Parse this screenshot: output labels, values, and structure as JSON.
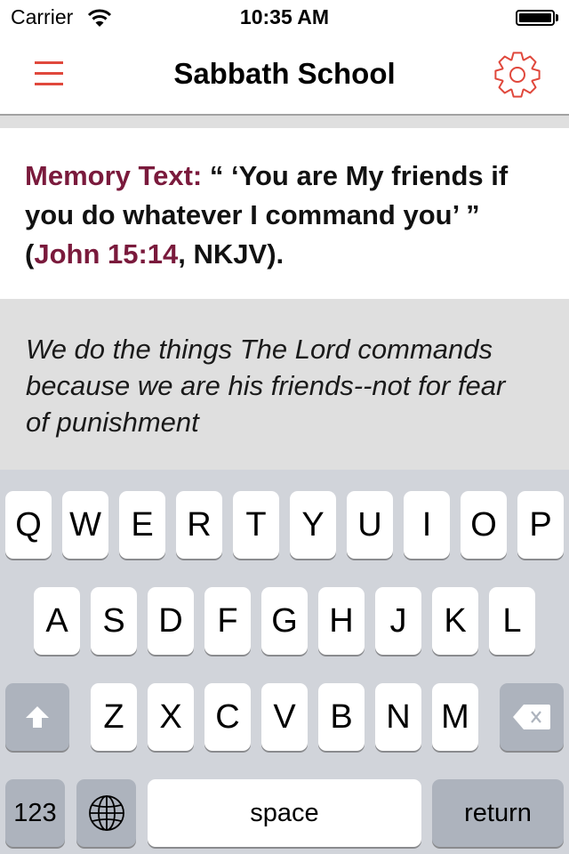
{
  "status_bar": {
    "carrier": "Carrier",
    "time": "10:35 AM",
    "wifi_icon": "wifi-icon",
    "battery_icon": "battery-full-icon"
  },
  "nav_bar": {
    "title": "Sabbath School",
    "menu_icon": "hamburger-menu-icon",
    "settings_icon": "gear-icon",
    "accent_color": "#e0483c"
  },
  "memory": {
    "label": "Memory Text:",
    "quote_part1": " “ ‘You are My friends if you do whatever I command you’ ” (",
    "reference": "John 15:14",
    "quote_part2": ", NKJV).",
    "accent_color": "#7a1a3c"
  },
  "note": {
    "text": "We do the things The Lord commands because we are his friends--not for fear of punishment"
  },
  "keyboard": {
    "row1": [
      "Q",
      "W",
      "E",
      "R",
      "T",
      "Y",
      "U",
      "I",
      "O",
      "P"
    ],
    "row2": [
      "A",
      "S",
      "D",
      "F",
      "G",
      "H",
      "J",
      "K",
      "L"
    ],
    "row3": [
      "Z",
      "X",
      "C",
      "V",
      "B",
      "N",
      "M"
    ],
    "shift_icon": "shift-arrow-icon",
    "delete_icon": "backspace-icon",
    "numbers_label": "123",
    "globe_icon": "globe-icon",
    "space_label": "space",
    "return_label": "return"
  }
}
